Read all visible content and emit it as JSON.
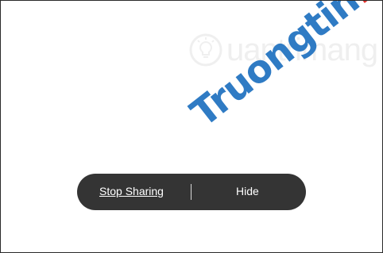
{
  "watermark": {
    "logo_text": "uantrimang",
    "site_main": "Truongtin",
    "site_tld": ".top",
    "colors": {
      "logo": "#e3e3e3",
      "main": "#2f7bc4",
      "tld": "#e3312d"
    }
  },
  "share_toolbar": {
    "stop_label": "Stop Sharing",
    "hide_label": "Hide",
    "background": "#343434"
  }
}
